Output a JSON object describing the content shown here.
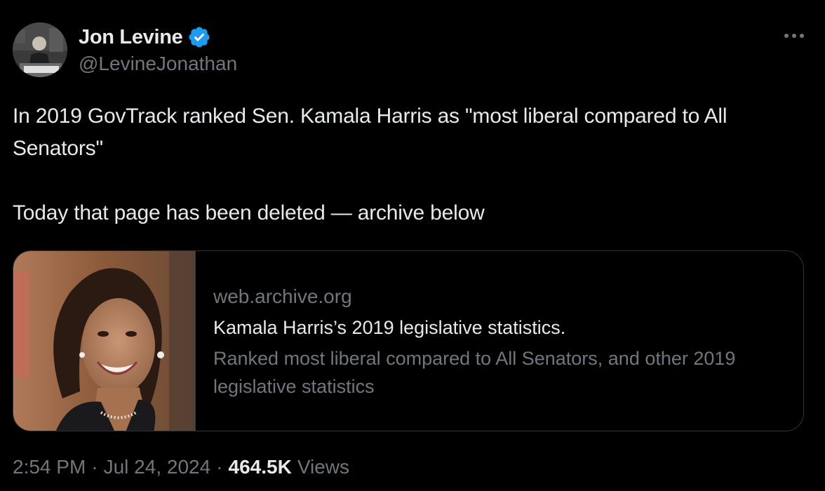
{
  "author": {
    "name": "Jon Levine",
    "handle": "@LevineJonathan",
    "verified": true,
    "verified_color": "#1d9bf0"
  },
  "tweet": {
    "paragraphs": [
      "In 2019 GovTrack ranked Sen. Kamala Harris as \"most liberal compared to All Senators\"",
      "Today that page has been deleted — archive below"
    ]
  },
  "card": {
    "domain": "web.archive.org",
    "title": "Kamala Harris’s 2019 legislative statistics.",
    "description": "Ranked most liberal compared to All Senators, and other 2019 legislative statistics"
  },
  "meta": {
    "time": "2:54 PM",
    "separator": "·",
    "date": "Jul 24, 2024",
    "views_count": "464.5K",
    "views_label": "Views"
  },
  "colors": {
    "background": "#000000",
    "text_primary": "#e7e9ea",
    "text_secondary": "#71767b",
    "border": "#2f3336"
  },
  "icons": {
    "more": "more-horizontal-icon",
    "verified": "verified-badge-icon"
  }
}
